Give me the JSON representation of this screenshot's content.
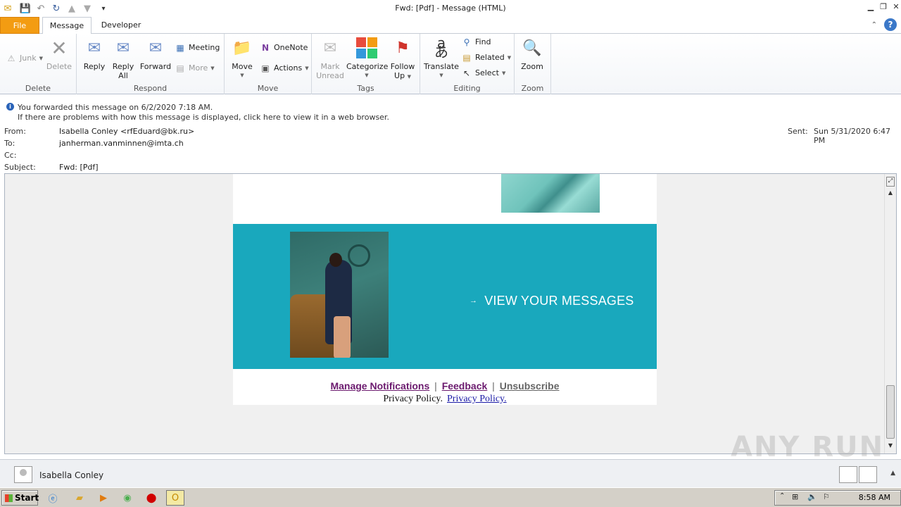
{
  "window": {
    "title": "Fwd: [Pdf]    -  Message (HTML)"
  },
  "tabs": [
    {
      "label": "File"
    },
    {
      "label": "Message"
    },
    {
      "label": "Developer"
    }
  ],
  "ribbon": {
    "delete_group": {
      "label": "Delete",
      "junk": "Junk",
      "delete": "Delete"
    },
    "respond_group": {
      "label": "Respond",
      "reply": "Reply",
      "reply_all_1": "Reply",
      "reply_all_2": "All",
      "forward": "Forward",
      "meeting": "Meeting",
      "more": "More"
    },
    "move_group": {
      "label": "Move",
      "move": "Move",
      "onenote": "OneNote",
      "actions": "Actions"
    },
    "tags_group": {
      "label": "Tags",
      "mark_unread_1": "Mark",
      "mark_unread_2": "Unread",
      "categorize": "Categorize",
      "follow_up_1": "Follow",
      "follow_up_2": "Up"
    },
    "editing_group": {
      "label": "Editing",
      "translate": "Translate",
      "find": "Find",
      "related": "Related",
      "select": "Select"
    },
    "zoom_group": {
      "label": "Zoom",
      "zoom": "Zoom"
    }
  },
  "info": {
    "line1": "You forwarded this message on 6/2/2020 7:18 AM.",
    "line2": "If there are problems with how this message is displayed, click here to view it in a web browser."
  },
  "headers": {
    "from_label": "From:",
    "from_value": "Isabella Conley <rfEduard@bk.ru>",
    "to_label": "To:",
    "to_value": "janherman.vanminnen@imta.ch",
    "cc_label": "Cc:",
    "subject_label": "Subject:",
    "subject_value": "Fwd: [Pdf]",
    "sent_label": "Sent:",
    "sent_value": "Sun 5/31/2020 6:47 PM"
  },
  "email": {
    "cta": "VIEW YOUR MESSAGES",
    "link_manage": "Manage Notifications",
    "link_feedback": "Feedback",
    "link_unsubscribe": "Unsubscribe",
    "separator": "|",
    "privacy_text": "Privacy Policy.",
    "privacy_link": "Privacy Policy."
  },
  "watermark": "ANY RUN",
  "people_pane": {
    "name": "Isabella Conley"
  },
  "taskbar": {
    "start": "Start",
    "clock": "8:58 AM"
  },
  "colors": {
    "banner": "#19a8bd",
    "file_tab": "#f39c12",
    "visited_link": "#6b1a6e"
  }
}
